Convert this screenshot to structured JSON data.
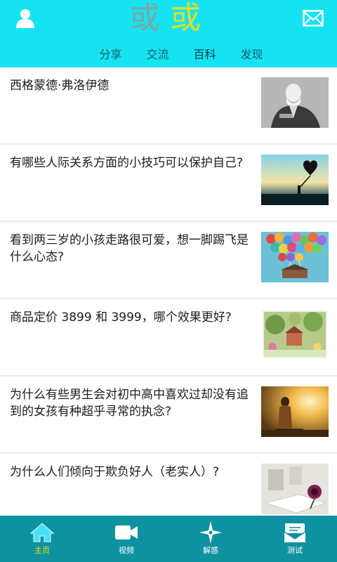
{
  "header": {
    "logo_left": "或",
    "logo_right": "或",
    "user_icon": "user-icon",
    "mail_icon": "mail-icon",
    "tabs": [
      {
        "label": "分享"
      },
      {
        "label": "交流"
      },
      {
        "label": "百科"
      },
      {
        "label": "发现"
      }
    ]
  },
  "feed": {
    "items": [
      {
        "title": "西格蒙德·弗洛伊德",
        "thumb": "portrait-photo"
      },
      {
        "title": "有哪些人际关系方面的小技巧可以保护自己?",
        "thumb": "sunset-heart-photo"
      },
      {
        "title": "看到两三岁的小孩走路很可爱，想一脚踢飞是什么心态?",
        "thumb": "balloons-photo"
      },
      {
        "title": "商品定价 3899 和 3999，哪个效果更好?",
        "thumb": "garden-scene-photo"
      },
      {
        "title": "为什么有些男生会对初中高中喜欢过却没有追到的女孩有种超乎寻常的执念?",
        "thumb": "golden-light-photo"
      },
      {
        "title": "为什么人们倾向于欺负好人（老实人）?",
        "thumb": "flower-book-photo"
      }
    ]
  },
  "bottom_nav": {
    "items": [
      {
        "label": "主页",
        "icon": "home-icon"
      },
      {
        "label": "视频",
        "icon": "video-camera-icon"
      },
      {
        "label": "解惑",
        "icon": "compass-star-icon"
      },
      {
        "label": "测试",
        "icon": "test-envelope-icon"
      }
    ]
  },
  "colors": {
    "header_bg": "#16e3f2",
    "nav_bg": "#0e92a0",
    "active_label": "#ffe600"
  }
}
